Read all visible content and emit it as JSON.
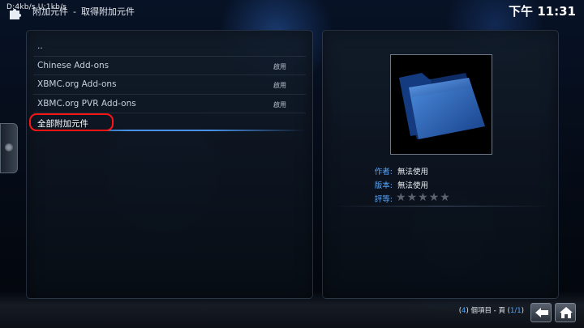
{
  "header": {
    "debug_text": "D:4kb/s   U:1kb/s",
    "breadcrumb": [
      "附加元件",
      "取得附加元件"
    ],
    "breadcrumb_separator": "-",
    "clock": "下午 11:31"
  },
  "list": {
    "items": [
      {
        "label": "..",
        "status": ""
      },
      {
        "label": "Chinese Add-ons",
        "status": "啟用"
      },
      {
        "label": "XBMC.org Add-ons",
        "status": "啟用"
      },
      {
        "label": "XBMC.org PVR Add-ons",
        "status": "啟用"
      },
      {
        "label": "全部附加元件",
        "status": "",
        "selected": true
      }
    ]
  },
  "details": {
    "author_label": "作者:",
    "author_value": "無法使用",
    "version_label": "版本:",
    "version_value": "無法使用",
    "rating_label": "評等:",
    "rating_stars": 0,
    "rating_max": 5
  },
  "footer": {
    "count": "4",
    "count_text": "個項目 - 頁",
    "page": "1/1"
  },
  "icons": {
    "breadcrumb_icon": "puzzle-icon",
    "thumbnail_icon": "folder-icon",
    "back_icon": "back-arrow-icon",
    "home_icon": "home-icon"
  },
  "colors": {
    "accent": "#4ea4ff",
    "selection_outline": "#ff1414"
  }
}
